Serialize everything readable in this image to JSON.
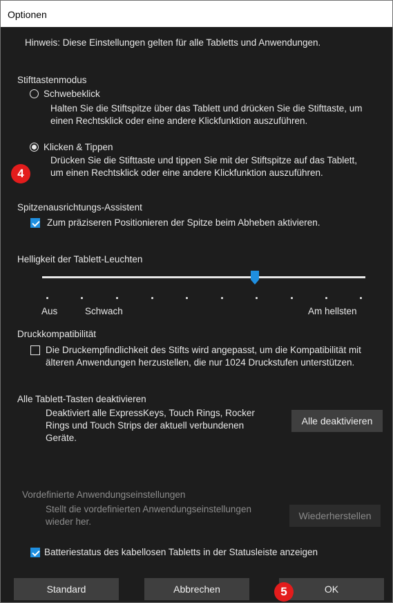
{
  "window": {
    "title": "Optionen"
  },
  "hint": "Hinweis: Diese Einstellungen gelten für alle Tabletts und Anwendungen.",
  "stylus_mode": {
    "heading": "Stifttastenmodus",
    "hover_label": "Schwebeklick",
    "hover_desc": "Halten Sie die Stiftspitze über das Tablett und drücken Sie die Stifttaste, um einen Rechtsklick oder eine andere Klickfunktion auszuführen.",
    "click_label": "Klicken & Tippen",
    "click_desc": "Drücken Sie die Stifttaste und tippen Sie mit der Stiftspitze auf das Tablett, um einen Rechtsklick oder eine andere Klickfunktion auszuführen.",
    "selected": "click"
  },
  "tip_assistant": {
    "heading": "Spitzenausrichtungs-Assistent",
    "checkbox_label": "Zum präziseren Positionieren der Spitze beim Abheben aktivieren.",
    "checked": true
  },
  "brightness": {
    "heading": "Helligkeit der Tablett-Leuchten",
    "label_off": "Aus",
    "label_low": "Schwach",
    "label_max": "Am hellsten",
    "level": 0.67
  },
  "pressure": {
    "heading": "Druckkompatibilität",
    "checkbox_label": "Die Druckempfindlichkeit des Stifts wird angepasst, um die Kompatibilität mit älteren Anwendungen herzustellen, die nur 1024 Druckstufen unterstützen.",
    "checked": false
  },
  "disable_keys": {
    "heading": "Alle Tablett-Tasten deaktivieren",
    "desc": "Deaktiviert alle ExpressKeys, Touch Rings, Rocker Rings und Touch Strips der aktuell verbundenen Geräte.",
    "button": "Alle deaktivieren"
  },
  "app_settings": {
    "heading": "Vordefinierte Anwendungseinstellungen",
    "desc": "Stellt die vordefinierten Anwendungseinstellungen wieder her.",
    "button": "Wiederherstellen"
  },
  "battery": {
    "checkbox_label": "Batteriestatus des kabellosen Tabletts in der Statusleiste anzeigen",
    "checked": true
  },
  "footer": {
    "standard": "Standard",
    "cancel": "Abbrechen",
    "ok": "OK"
  },
  "badges": {
    "step4": "4",
    "step5": "5"
  },
  "colors": {
    "accent": "#1f8fe0",
    "badge": "#e31c1c",
    "background": "#1d1d1d"
  }
}
